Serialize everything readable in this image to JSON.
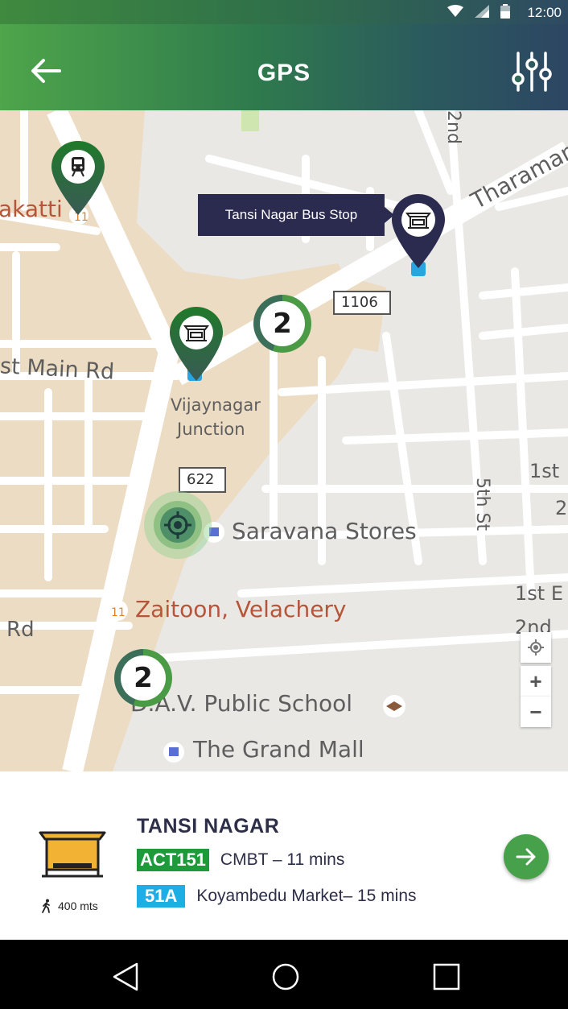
{
  "status_bar": {
    "time": "12:00",
    "icons": [
      "wifi-icon",
      "signal-icon",
      "battery-icon"
    ]
  },
  "app_bar": {
    "title": "GPS",
    "back_icon": "arrow-left-icon",
    "filter_icon": "sliders-icon"
  },
  "map": {
    "labels": {
      "akatti": "akatti",
      "main_rd": "st Main Rd",
      "vijaynagar_1": "Vijaynagar",
      "vijaynagar_2": "Junction",
      "shield_1106": "1106",
      "shield_622": "622",
      "saravana": "Saravana Stores",
      "zaitoon": "Zaitoon, Velachery",
      "dav": "D.A.V. Public School",
      "grand_mall": "The Grand Mall",
      "rd_left": "Rd",
      "tharaman": "Tharaman",
      "second": "2nd",
      "fifth_st": "5th St",
      "first_st": "1st",
      "first_e": "1st E",
      "second_r": "2nd",
      "two": "2",
      "bottom_left": "in Rd"
    },
    "callout": "Tansi Nagar Bus Stop",
    "clusters": [
      {
        "count": "2"
      },
      {
        "count": "2"
      }
    ],
    "zoom": {
      "in": "+",
      "out": "−"
    }
  },
  "card": {
    "stop_name": "TANSI NAGAR",
    "walk_distance": "400 mts",
    "routes": [
      {
        "number": "ACT151",
        "destination": "CMBT – 11 mins",
        "color": "#1e9a3b"
      },
      {
        "number": "51A",
        "destination": "Koyambedu Market– 15 mins",
        "color": "#1eaee6"
      }
    ]
  },
  "colors": {
    "green": "#47a14a",
    "navy": "#2b2a4f",
    "dark_green": "#1f6b2b"
  }
}
